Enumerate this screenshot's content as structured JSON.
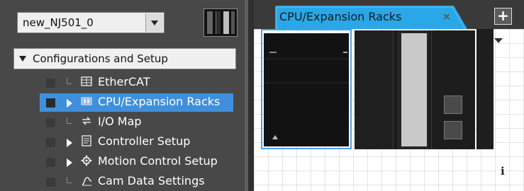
{
  "device": {
    "selected": "new_NJ501_0"
  },
  "tree": {
    "section_label": "Configurations and Setup",
    "items": [
      {
        "label": "EtherCAT",
        "icon": "ethercat-icon",
        "expandable": false,
        "selected": false
      },
      {
        "label": "CPU/Expansion Racks",
        "icon": "rack-icon",
        "expandable": true,
        "selected": true
      },
      {
        "label": "I/O Map",
        "icon": "io-map-icon",
        "expandable": false,
        "selected": false
      },
      {
        "label": "Controller Setup",
        "icon": "controller-setup-icon",
        "expandable": true,
        "selected": false
      },
      {
        "label": "Motion Control Setup",
        "icon": "motion-gear-icon",
        "expandable": true,
        "selected": false
      },
      {
        "label": "Cam Data Settings",
        "icon": "cam-data-icon",
        "expandable": false,
        "selected": false
      }
    ]
  },
  "editor": {
    "tab_label": "CPU/Expansion Racks",
    "close_glyph": "×",
    "add_glyph": "+",
    "info_glyph": "i"
  },
  "colors": {
    "selection": "#3f90dc",
    "tab_background": "#2aa7e6",
    "pane_background": "#484848"
  }
}
